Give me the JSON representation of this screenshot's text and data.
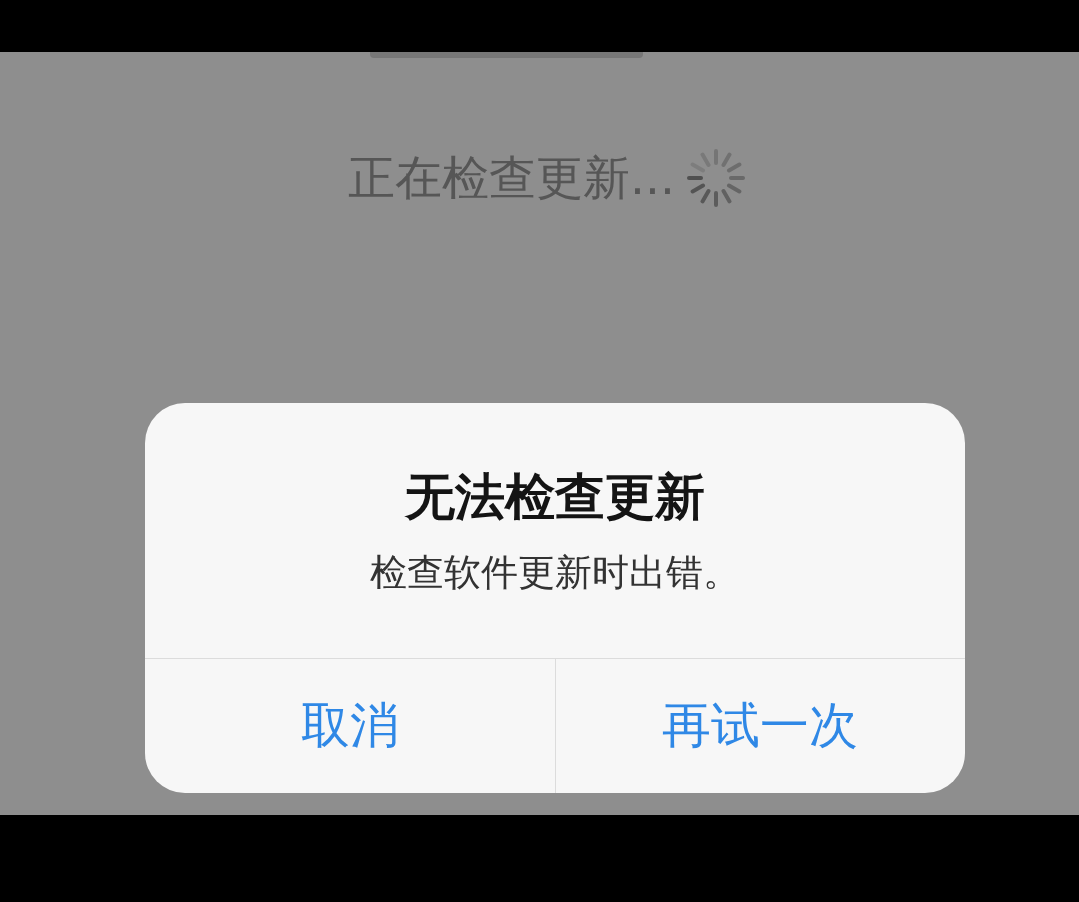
{
  "background": {
    "status_text": "正在检查更新..."
  },
  "alert": {
    "title": "无法检查更新",
    "message": "检查软件更新时出错。",
    "buttons": [
      {
        "label": "取消"
      },
      {
        "label": "再试一次"
      }
    ]
  }
}
